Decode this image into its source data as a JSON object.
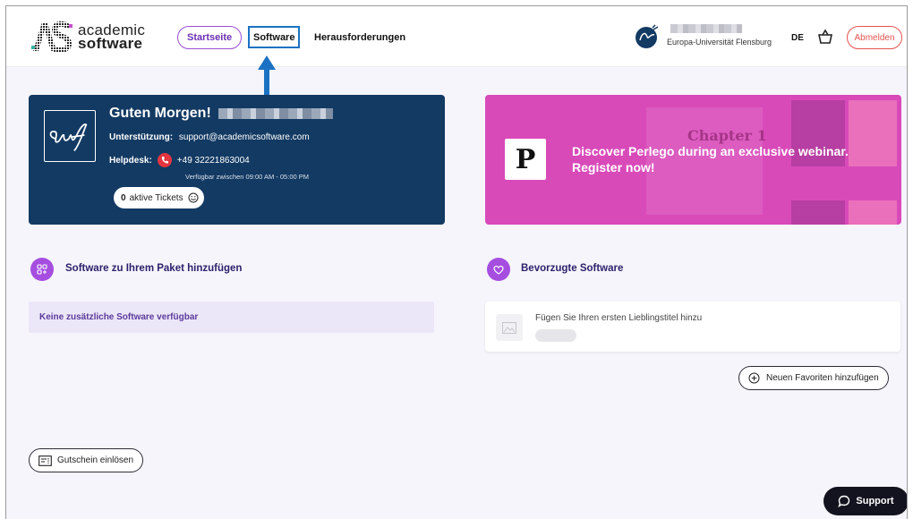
{
  "header": {
    "logo": {
      "line1": "academic",
      "line2": "software"
    },
    "nav": {
      "home": "Startseite",
      "software": "Software",
      "challenges": "Herausforderungen"
    },
    "user": {
      "university": "Europa-Universität Flensburg"
    },
    "language": "DE",
    "logout": "Abmelden"
  },
  "greeting": {
    "title": "Guten Morgen!",
    "support_label": "Unterstützung:",
    "support_email": "support@academicsoftware.com",
    "helpdesk_label": "Helpdesk:",
    "helpdesk_phone": "+49 32221863004",
    "hours": "Verfügbar zwischen 09:00 AM - 05:00 PM",
    "tickets_count": "0",
    "tickets_label": "aktive Tickets"
  },
  "promo": {
    "logo_letter": "P",
    "chapter": "Chapter 1",
    "text": "Discover Perlego during an exclusive webinar. Register now!"
  },
  "add_software": {
    "title": "Software zu Ihrem Paket hinzufügen",
    "empty": "Keine zusätzliche Software verfügbar"
  },
  "favorites": {
    "title": "Bevorzugte Software",
    "placeholder": "Fügen Sie Ihren ersten Lieblingstitel hinzu",
    "add_button": "Neuen Favoriten hinzufügen"
  },
  "voucher_button": "Gutschein einlösen",
  "support_button": "Support",
  "colors": {
    "primary_purple": "#a54ee0",
    "navy_card": "#133a63",
    "promo_pink": "#d94ab9",
    "highlight_blue": "#1b72c2",
    "logout_red": "#e3544f"
  }
}
